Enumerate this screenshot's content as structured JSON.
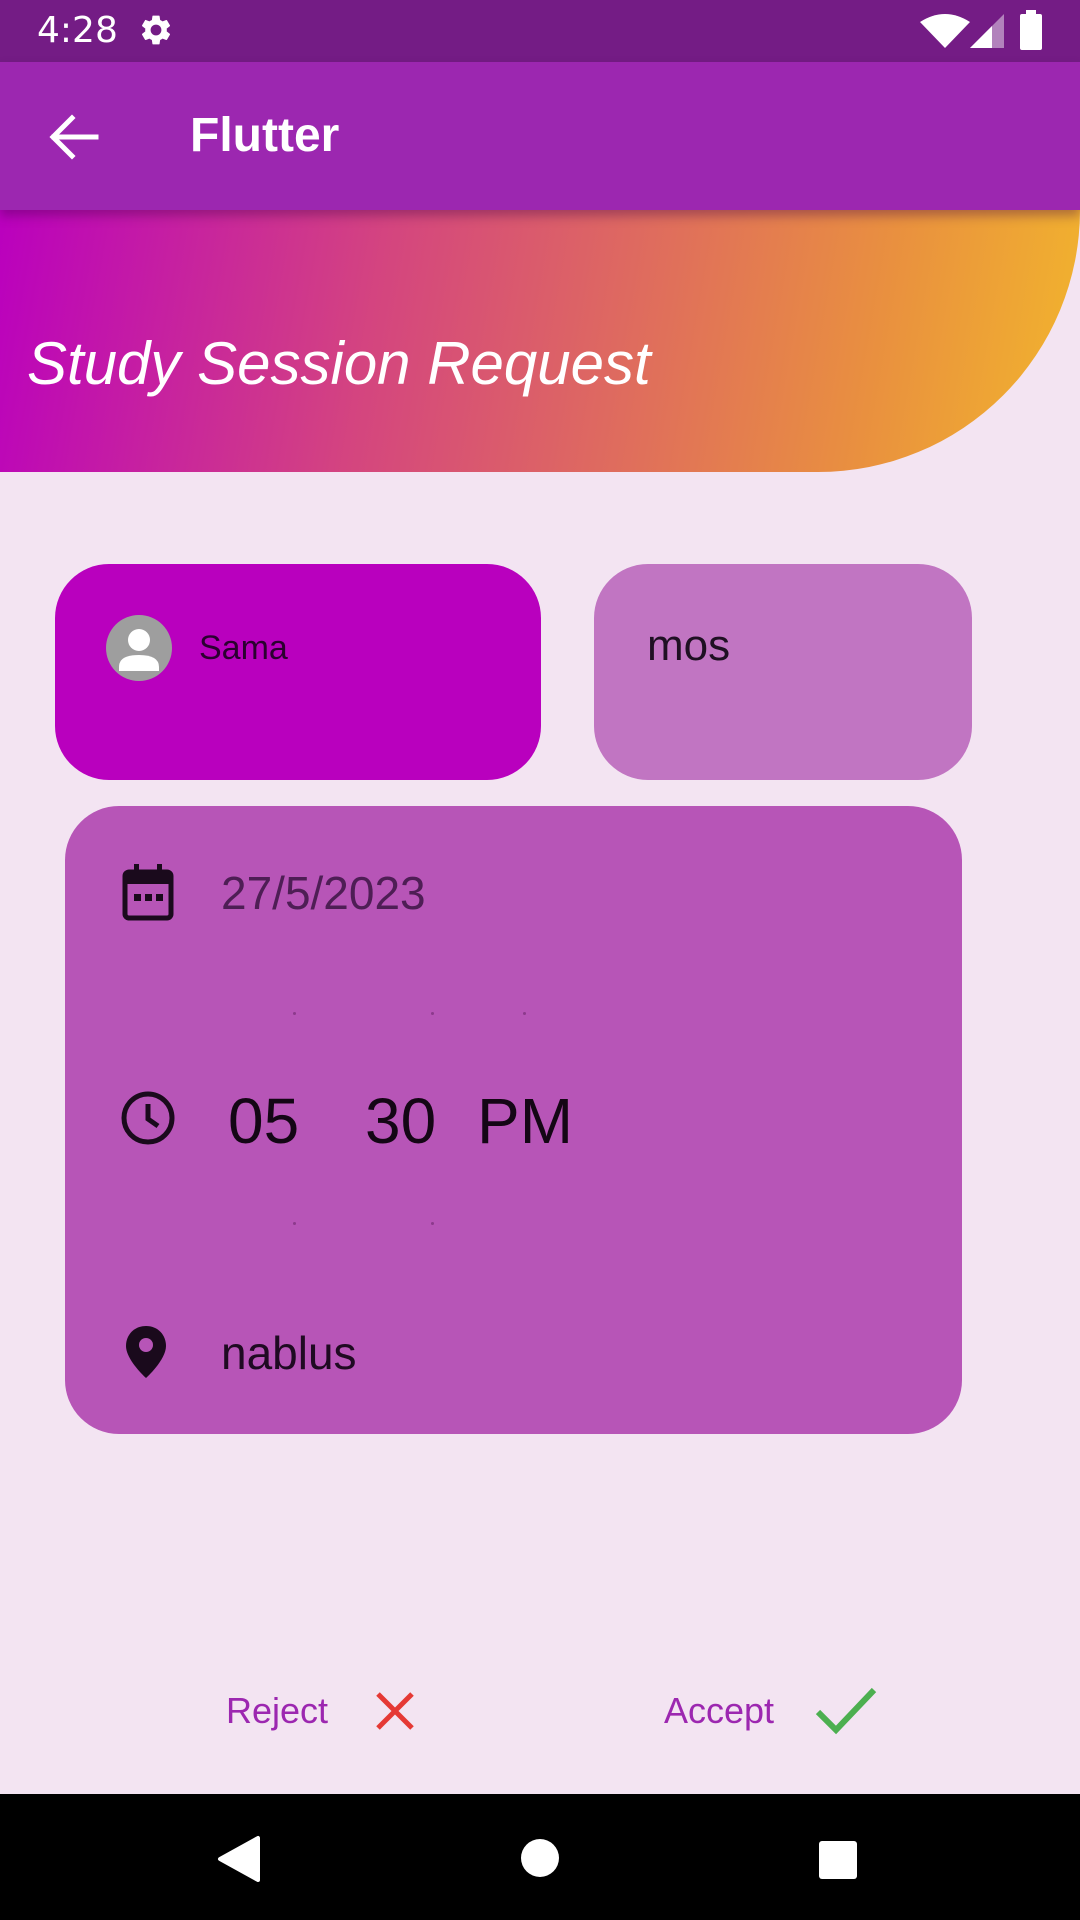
{
  "status_bar": {
    "time": "4:28",
    "icons": [
      "settings-icon",
      "wifi-icon",
      "signal-icon",
      "battery-icon"
    ]
  },
  "app_bar": {
    "title": "Flutter",
    "back_icon": "arrow-back-icon"
  },
  "banner": {
    "title": "Study Session Request",
    "gradient_colors": [
      "#BA00BE",
      "#D4457F",
      "#E9903F",
      "#F2B62C"
    ]
  },
  "sender": {
    "name": "Sama",
    "avatar_icon": "person-icon",
    "card_color": "#B900BE"
  },
  "course": {
    "name": "mos",
    "card_color": "#C175C2"
  },
  "details": {
    "date": "27/5/2023",
    "time": {
      "hour": "05",
      "minute": "30",
      "period": "PM"
    },
    "location": "nablus",
    "card_color": "#B755B7",
    "icons": [
      "calendar-icon",
      "clock-icon",
      "location-pin-icon"
    ]
  },
  "actions": {
    "reject_label": "Reject",
    "accept_label": "Accept",
    "reject_icon": "close-icon",
    "accept_icon": "check-icon",
    "reject_icon_color": "#E53935",
    "accept_icon_color": "#4CAF50",
    "label_color": "#9C27B0"
  },
  "navigation_bar": {
    "icons": [
      "nav-back-icon",
      "nav-home-icon",
      "nav-recents-icon"
    ]
  },
  "colors": {
    "status_bar": "#741C85",
    "app_bar": "#9C27B0",
    "background": "#F3E4F2"
  }
}
